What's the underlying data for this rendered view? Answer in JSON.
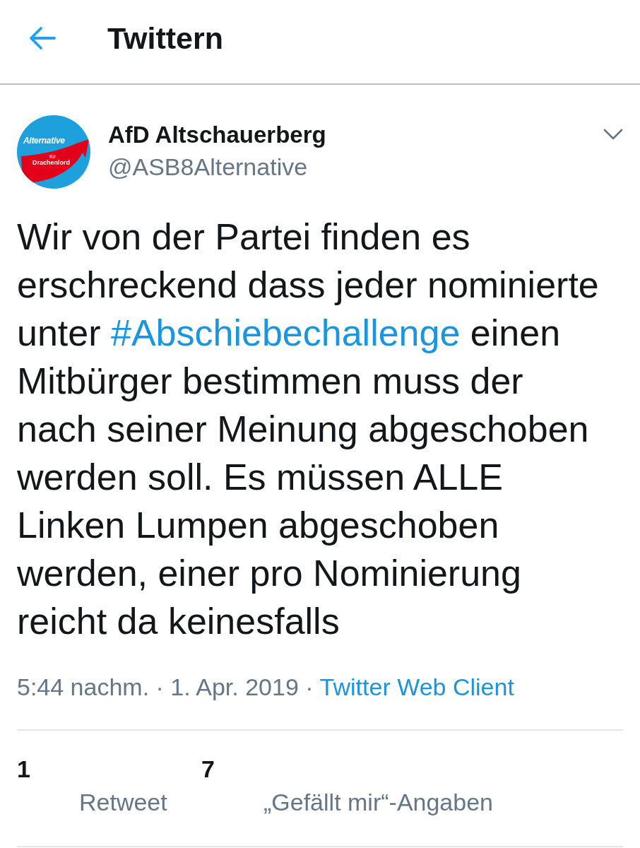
{
  "header": {
    "title": "Twittern"
  },
  "tweet": {
    "author": {
      "name": "AfD Altschauerberg",
      "handle": "@ASB8Alternative",
      "avatar": {
        "logo": {
          "top": "Alternative",
          "middle": "für",
          "bottom": "Drachenlord"
        }
      }
    },
    "text": [
      {
        "kind": "plain",
        "text": "Wir von der Partei finden es erschreckend dass jeder nominierte unter "
      },
      {
        "kind": "hashtag",
        "text": "#Abschiebechallenge"
      },
      {
        "kind": "plain",
        "text": " einen Mitbürger bestimmen muss der nach seiner Meinung abgeschoben werden soll. Es müssen ALLE Linken Lumpen abgeschoben werden, einer pro Nominierung reicht da keinesfalls"
      }
    ],
    "meta": {
      "timestamp": "5:44 nachm. · 1. Apr. 2019 ·",
      "source": "Twitter Web Client"
    },
    "stats": [
      {
        "count": "1",
        "label": "Retweet"
      },
      {
        "count": "7",
        "label": "„Gefällt mir“-Angaben"
      }
    ]
  }
}
